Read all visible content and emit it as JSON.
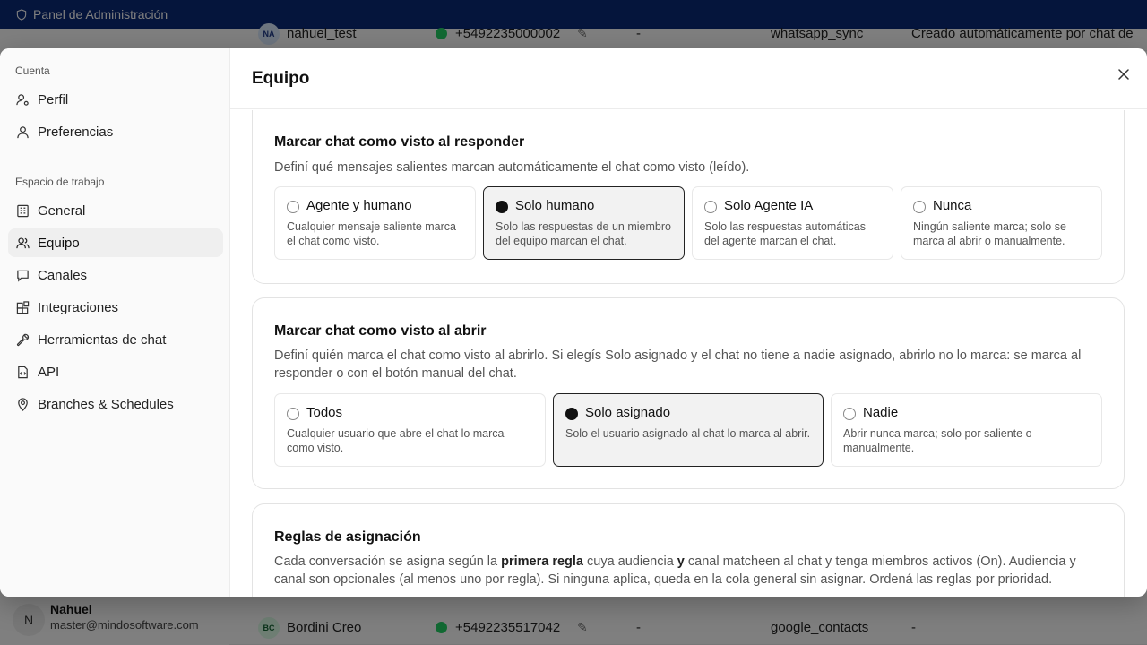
{
  "app": {
    "title": "Panel de Administración"
  },
  "background_rows": [
    {
      "initials": "NA",
      "name": "nahuel_test",
      "phone": "+5492235000002",
      "dash": "-",
      "source": "whatsapp_sync",
      "note": "Creado automáticamente por chat de",
      "avatar_bg": "#dbeafe",
      "avatar_fg": "#1e3a8a"
    },
    {
      "initials": "BC",
      "name": "Bordini Creo",
      "phone": "+5492235517042",
      "dash": "-",
      "source": "google_contacts",
      "note": "-",
      "avatar_bg": "#dcfce7",
      "avatar_fg": "#166534"
    }
  ],
  "user": {
    "initial": "N",
    "name": "Nahuel",
    "email": "master@mindosoftware.com"
  },
  "modal": {
    "title": "Equipo",
    "close_icon": "close-icon",
    "sidebar": {
      "account_label": "Cuenta",
      "account_items": [
        {
          "label": "Perfil",
          "icon": "user-settings-icon"
        },
        {
          "label": "Preferencias",
          "icon": "user-icon"
        }
      ],
      "workspace_label": "Espacio de trabajo",
      "workspace_items": [
        {
          "label": "General",
          "icon": "building-icon"
        },
        {
          "label": "Equipo",
          "icon": "users-icon",
          "active": true
        },
        {
          "label": "Canales",
          "icon": "chat-bubble-icon"
        },
        {
          "label": "Integraciones",
          "icon": "blocks-icon"
        },
        {
          "label": "Herramientas de chat",
          "icon": "wrench-icon"
        },
        {
          "label": "API",
          "icon": "file-code-icon"
        },
        {
          "label": "Branches & Schedules",
          "icon": "map-pin-icon"
        }
      ]
    },
    "sections": {
      "respond": {
        "title": "Marcar chat como visto al responder",
        "description": "Definí qué mensajes salientes marcan automáticamente el chat como visto (leído).",
        "options": [
          {
            "label": "Agente y humano",
            "description": "Cualquier mensaje saliente marca el chat como visto.",
            "selected": false
          },
          {
            "label": "Solo humano",
            "description": "Solo las respuestas de un miembro del equipo marcan el chat.",
            "selected": true
          },
          {
            "label": "Solo Agente IA",
            "description": "Solo las respuestas automáticas del agente marcan el chat.",
            "selected": false
          },
          {
            "label": "Nunca",
            "description": "Ningún saliente marca; solo se marca al abrir o manualmente.",
            "selected": false
          }
        ]
      },
      "open": {
        "title": "Marcar chat como visto al abrir",
        "description": "Definí quién marca el chat como visto al abrirlo. Si elegís Solo asignado y el chat no tiene a nadie asignado, abrirlo no lo marca: se marca al responder o con el botón manual del chat.",
        "options": [
          {
            "label": "Todos",
            "description": "Cualquier usuario que abre el chat lo marca como visto.",
            "selected": false
          },
          {
            "label": "Solo asignado",
            "description": "Solo el usuario asignado al chat lo marca al abrir.",
            "selected": true
          },
          {
            "label": "Nadie",
            "description": "Abrir nunca marca; solo por saliente o manualmente.",
            "selected": false
          }
        ]
      },
      "rules": {
        "title": "Reglas de asignación",
        "desc_part1": "Cada conversación se asigna según la ",
        "desc_bold1": "primera regla",
        "desc_part2": " cuya audiencia ",
        "desc_bold2": "y",
        "desc_part3": " canal matcheen al chat y tenga miembros activos (On). Audiencia y canal son opcionales (al menos uno por regla). Si ninguna aplica, queda en la cola general sin asignar. Ordená las reglas por prioridad."
      }
    }
  }
}
